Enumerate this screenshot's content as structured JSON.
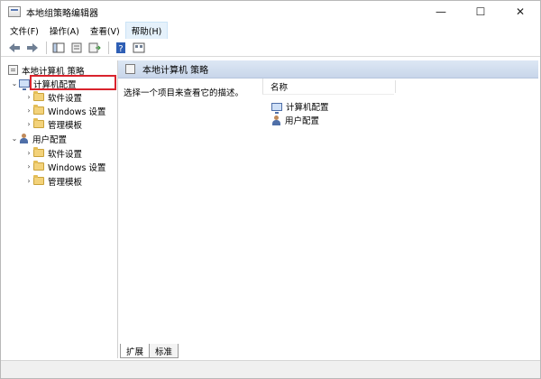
{
  "window": {
    "title": "本地组策略编辑器",
    "controls": {
      "minimize": "—",
      "maximize": "☐",
      "close": "✕"
    }
  },
  "menu": [
    {
      "label": "文件(F)"
    },
    {
      "label": "操作(A)"
    },
    {
      "label": "查看(V)"
    },
    {
      "label": "帮助(H)"
    }
  ],
  "toolbar": {
    "icons": [
      "back-icon",
      "forward-icon",
      "show-hide-tree-icon",
      "properties-icon",
      "export-list-icon",
      "help-icon",
      "view-icon"
    ]
  },
  "tree": {
    "root": "本地计算机 策略",
    "computer": {
      "label": "计算机配置",
      "children": [
        "软件设置",
        "Windows 设置",
        "管理模板"
      ]
    },
    "user": {
      "label": "用户配置",
      "children": [
        "软件设置",
        "Windows 设置",
        "管理模板"
      ]
    }
  },
  "content": {
    "header": "本地计算机 策略",
    "description": "选择一个项目来查看它的描述。",
    "column_name": "名称",
    "items": [
      "计算机配置",
      "用户配置"
    ]
  },
  "tabs": [
    "扩展",
    "标准"
  ],
  "colors": {
    "highlight": "#d9232d",
    "header_bg": "#c8d6ea"
  }
}
